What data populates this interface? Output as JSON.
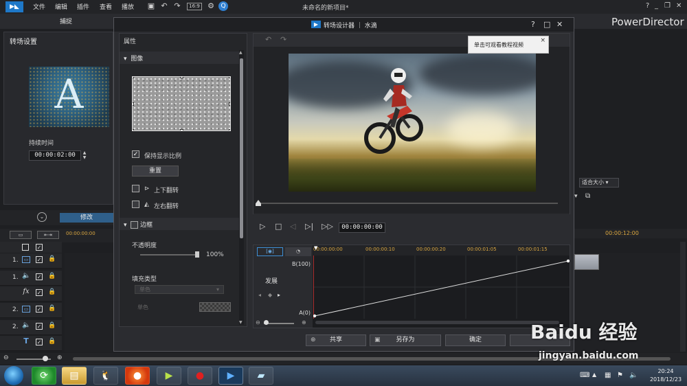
{
  "app": {
    "menu": [
      "文件",
      "编辑",
      "插件",
      "查看",
      "播放"
    ],
    "title": "未命名的新项目*",
    "brand": "PowerDirector",
    "capture_tab": "捕捉"
  },
  "left_panel": {
    "title": "转场设置",
    "thumb_letter": "A",
    "duration_label": "持续时间",
    "duration_value": "00:00:02:00"
  },
  "modify_button": "修改",
  "timeline": {
    "start_time": "00:00:00:00",
    "right_time": "00:00:12:00",
    "tracks": [
      {
        "num": "1.",
        "type": "video-icon"
      },
      {
        "num": "1.",
        "type": "audio-icon"
      },
      {
        "num": "",
        "type": "fx-icon",
        "label": "fx"
      },
      {
        "num": "2.",
        "type": "video-icon"
      },
      {
        "num": "2.",
        "type": "audio-icon"
      },
      {
        "num": "",
        "type": "title-icon",
        "label": "T"
      }
    ],
    "fit_label": "适合大小"
  },
  "dialog": {
    "title": "转场设计器 ｜ 水滴",
    "help": "?",
    "properties": {
      "header": "属性",
      "section_image": "图像",
      "keep_ratio": "保持显示比例",
      "reset": "重置",
      "flip_vertical": "上下翻转",
      "flip_horizontal": "左右翻转",
      "section_border": "边框",
      "opacity_label": "不透明度",
      "opacity_value": "100%",
      "fill_type_label": "填充类型",
      "fill_type_value": "单色",
      "color_label": "单色"
    },
    "tooltip": "单击可观看教程视频",
    "timecode": "00:00:00:00",
    "keyframe": {
      "ruler": [
        "00:00:00:00",
        "00:00:00:10",
        "00:00:00:20",
        "00:00:01:05",
        "00:00:01:15"
      ],
      "expand_label": "发展",
      "b_label": "B(100)",
      "a_label": "A(0)"
    },
    "buttons": {
      "share": "共享",
      "save_as": "另存为",
      "ok": "确定"
    }
  },
  "taskbar": {
    "time": "20:24",
    "date": "2018/12/23"
  },
  "watermark": {
    "text": "Baidu 经验",
    "url": "jingyan.baidu.com"
  }
}
